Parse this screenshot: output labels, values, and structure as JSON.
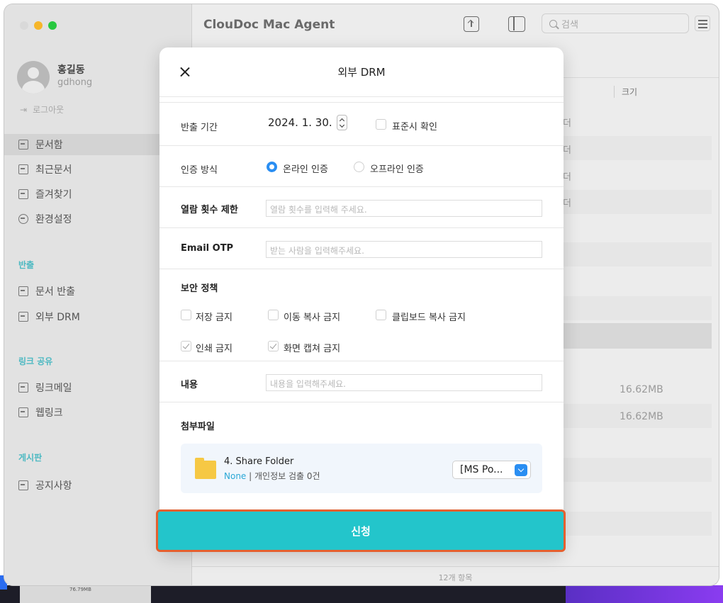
{
  "window": {
    "title": "ClouDoc Mac Agent"
  },
  "toolbar": {
    "search_placeholder": "검색",
    "upload_icon": "upload-icon",
    "panel_icon": "sidebar-panel-icon",
    "filter_icon": "filter-icon"
  },
  "user": {
    "name": "홍길동",
    "id": "gdhong",
    "logout_label": "로그아웃"
  },
  "sidebar": {
    "items": [
      {
        "label": "문서함",
        "icon": "folder-icon",
        "active": true
      },
      {
        "label": "최근문서",
        "icon": "recent-doc-icon"
      },
      {
        "label": "즐겨찾기",
        "icon": "favorite-icon"
      },
      {
        "label": "환경설정",
        "icon": "gear-icon"
      }
    ],
    "export_section": "반출",
    "export_items": [
      {
        "label": "문서 반출",
        "icon": "export-doc-icon"
      },
      {
        "label": "외부 DRM",
        "icon": "external-drm-icon"
      }
    ],
    "link_section": "링크 공유",
    "link_items": [
      {
        "label": "링크메일",
        "icon": "link-mail-icon"
      },
      {
        "label": "웹링크",
        "icon": "web-link-icon"
      }
    ],
    "board_section": "게시판",
    "board_items": [
      {
        "label": "공지사항",
        "icon": "notice-icon"
      }
    ]
  },
  "file_list": {
    "size_header": "크기",
    "row_fragments": [
      "더",
      "더",
      "더",
      "더"
    ],
    "sizes": [
      "16.62MB",
      "16.62MB"
    ],
    "status": "12개 항목"
  },
  "modal": {
    "title": "외부 DRM",
    "export_period_label": "반출 기간",
    "export_date": "2024.  1. 30.",
    "standard_time_label": "표준시 확인",
    "auth_method_label": "인증 방식",
    "online_auth_label": "온라인 인증",
    "offline_auth_label": "오프라인 인증",
    "view_limit_label": "열람 횟수 제한",
    "view_limit_placeholder": "열람 횟수를 입력해 주세요.",
    "email_otp_label": "Email OTP",
    "email_otp_placeholder": "받는 사람을 입력해주세요.",
    "security_policy_label": "보안 정책",
    "policies": [
      {
        "label": "저장 금지",
        "checked": false
      },
      {
        "label": "이동 복사 금지",
        "checked": false
      },
      {
        "label": "클립보드 복사 금지",
        "checked": false
      },
      {
        "label": "인쇄 금지",
        "checked": true
      },
      {
        "label": "화면 캡쳐 금지",
        "checked": true
      }
    ],
    "content_label": "내용",
    "content_placeholder": "내용을 입력해주세요.",
    "attachment_label": "첨부파일",
    "attachment": {
      "name": "4. Share Folder",
      "status_tag": "None",
      "separator": "|",
      "status_detail": "개인정보 검출 0건",
      "policy_selected": "[MS Po..."
    },
    "submit_label": "신청"
  },
  "desktop": {
    "thumb_size": "76.79MB"
  },
  "colors": {
    "accent": "#23c5cb",
    "section": "#4db9c2",
    "radio_on": "#2a8ef2",
    "highlight": "#e5602f"
  }
}
